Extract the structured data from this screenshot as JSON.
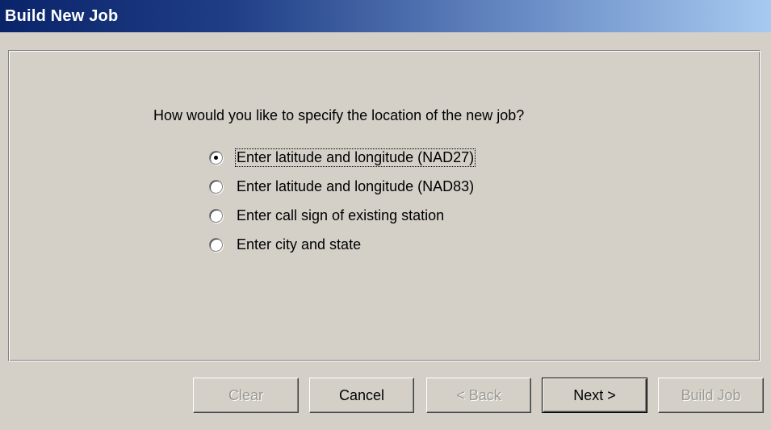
{
  "window": {
    "title": "Build New Job"
  },
  "colors": {
    "titlebar_start": "#0a246a",
    "titlebar_end": "#a6caf0",
    "background": "#d4d0c8",
    "disabled_text": "#9a9890"
  },
  "main": {
    "question": "How would you like to specify the location of the new job?",
    "options": [
      {
        "label": "Enter latitude and longitude (NAD27)",
        "checked": true,
        "focused": true
      },
      {
        "label": "Enter latitude and longitude (NAD83)",
        "checked": false,
        "focused": false
      },
      {
        "label": "Enter call sign of existing station",
        "checked": false,
        "focused": false
      },
      {
        "label": "Enter city and state",
        "checked": false,
        "focused": false
      }
    ]
  },
  "buttons": {
    "clear": {
      "label": "Clear",
      "enabled": false
    },
    "cancel": {
      "label": "Cancel",
      "enabled": true
    },
    "back": {
      "label": "< Back",
      "enabled": false
    },
    "next": {
      "label": "Next >",
      "enabled": true,
      "default": true
    },
    "build_job": {
      "label": "Build Job",
      "enabled": false
    }
  }
}
